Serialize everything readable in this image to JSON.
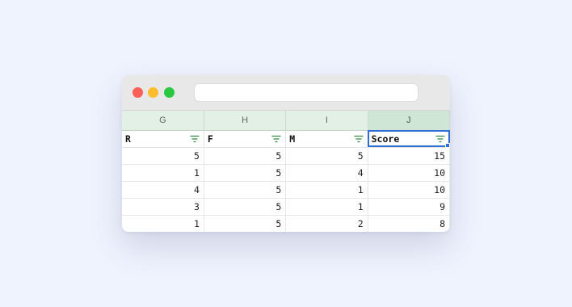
{
  "columns": [
    {
      "letter": "G",
      "field": "R"
    },
    {
      "letter": "H",
      "field": "F"
    },
    {
      "letter": "I",
      "field": "M"
    },
    {
      "letter": "J",
      "field": "Score"
    }
  ],
  "rows": [
    [
      "5",
      "5",
      "5",
      "15"
    ],
    [
      "1",
      "5",
      "4",
      "10"
    ],
    [
      "4",
      "5",
      "1",
      "10"
    ],
    [
      "3",
      "5",
      "1",
      "9"
    ],
    [
      "1",
      "5",
      "2",
      "8"
    ]
  ],
  "active_column": "J",
  "filter_icon": "filter-icon",
  "colors": {
    "header_bg": "#e2f0e6",
    "active_header_bg": "#cfe6d6",
    "selection": "#2f6fd6",
    "filter_icon": "#3c8a4e"
  }
}
